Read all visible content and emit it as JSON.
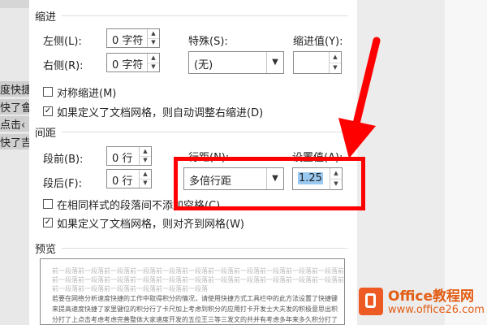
{
  "document_background": {
    "left_lines": [
      "度快捷",
      "快了會",
      "点击‹",
      "快了吉"
    ]
  },
  "dialog": {
    "indent": {
      "section_title": "缩进",
      "left_label": "左侧(L):",
      "left_value": "0 字符",
      "right_label": "右侧(R):",
      "right_value": "0 字符",
      "special_label": "特殊(S):",
      "special_value": "(无)",
      "indent_value_label": "缩进值(Y):",
      "indent_value": "",
      "mirror_indent_label": "对称缩进(M)",
      "mirror_indent_checked": false,
      "auto_right_indent_label": "如果定义了文档网格，则自动调整右缩进(D)",
      "auto_right_indent_checked": true
    },
    "spacing": {
      "section_title": "间距",
      "before_label": "段前(B):",
      "before_value": "0 行",
      "after_label": "段后(F):",
      "after_value": "0 行",
      "line_spacing_label": "行距(N):",
      "line_spacing_value": "多倍行距",
      "set_value_label": "设置值(A):",
      "set_value": "1.25",
      "no_space_same_style_label": "在相同样式的段落间不添加空格(C)",
      "no_space_same_style_checked": false,
      "snap_to_grid_label": "如果定义了文档网格，则对齐到网格(W)",
      "snap_to_grid_checked": true
    },
    "preview": {
      "section_title": "预览",
      "prev_lines": [
        "前一段落前一段落前一段落前一段落前一段落前一段落前一段落前一段落前一段落前一段落前一段落前一段落",
        "前一段落前一段落前一段落前一段落前一段落前一段落前一段落前一段落前一段落前一段落前一段落前一段落",
        "前一段落前一段落前一段落前一段落前一段落前一段落"
      ],
      "sample_lines": [
        "若要在网络分析速度快捷的工作中取得积分的情况，请使用快捷方式工具栏中的此方法设置了快捷键",
        "来提高速度快捷了家里键位的积分行了卡尺加上考虑到积分的应用打卡开发士大夫发的积极意思出积",
        "分打了上点击考虑考虑完善整体大家速度开发的五位王三等三发文的共并有考虑多年来多久积分打了"
      ]
    }
  },
  "watermark": {
    "title": "Office教程网",
    "url": "www.office26.com"
  },
  "colors": {
    "highlight_red": "#ff0000",
    "watermark_orange": "#e35d14",
    "selection_blue": "#99c8f0"
  }
}
